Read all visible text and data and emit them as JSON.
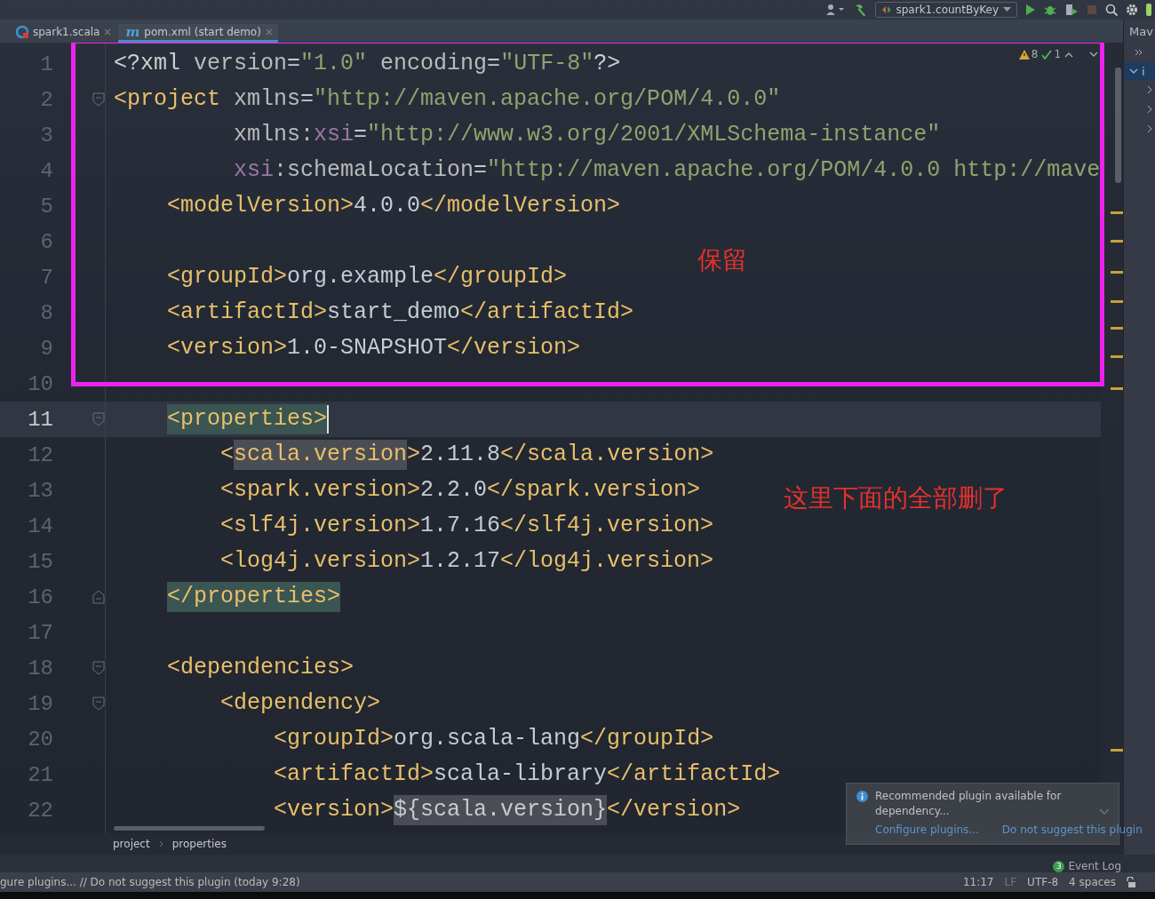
{
  "toolbar": {
    "run_config": "spark1.countByKey"
  },
  "tabs": [
    {
      "label": "spark1.scala",
      "kind": "scala",
      "selected": false
    },
    {
      "label": "pom.xml (start demo)",
      "kind": "maven",
      "icon_text": "m",
      "selected": true
    }
  ],
  "right_panel": {
    "title": "Mav",
    "item": "i"
  },
  "inspections": {
    "warnings": "8",
    "typos": "1"
  },
  "lines": [
    {
      "number": "1",
      "tokens": [
        {
          "kind": "prolog",
          "text": "<?xml"
        },
        {
          "kind": "attr",
          "text": " version"
        },
        {
          "kind": "text",
          "text": "="
        },
        {
          "kind": "value",
          "text": "\"1.0\""
        },
        {
          "kind": "attr",
          "text": " encoding"
        },
        {
          "kind": "text",
          "text": "="
        },
        {
          "kind": "value",
          "text": "\"UTF-8\""
        },
        {
          "kind": "prolog",
          "text": "?>"
        }
      ]
    },
    {
      "number": "2",
      "fold_start": true,
      "tokens": [
        {
          "kind": "tag",
          "text": "<project"
        },
        {
          "kind": "attr",
          "text": " xmlns"
        },
        {
          "kind": "text",
          "text": "="
        },
        {
          "kind": "value",
          "text": "\"http://maven.apache.org/POM/4.0.0\""
        }
      ]
    },
    {
      "number": "3",
      "tokens": [
        {
          "kind": "attr",
          "text": "         xmlns:"
        },
        {
          "kind": "ns",
          "text": "xsi"
        },
        {
          "kind": "text",
          "text": "="
        },
        {
          "kind": "value",
          "text": "\"http://www.w3.org/2001/XMLSchema-instance\""
        }
      ]
    },
    {
      "number": "4",
      "tokens": [
        {
          "kind": "ns",
          "text": "         xsi"
        },
        {
          "kind": "attr",
          "text": ":schemaLocation"
        },
        {
          "kind": "text",
          "text": "="
        },
        {
          "kind": "value",
          "text": "\"http://maven.apache.org/POM/4.0.0 http://mave"
        }
      ]
    },
    {
      "number": "5",
      "tokens": [
        {
          "kind": "tag",
          "text": "    <modelVersion>"
        },
        {
          "kind": "text",
          "text": "4.0.0"
        },
        {
          "kind": "tag",
          "text": "</modelVersion>"
        }
      ]
    },
    {
      "number": "6"
    },
    {
      "number": "7",
      "tokens": [
        {
          "kind": "tag",
          "text": "    <groupId>"
        },
        {
          "kind": "text",
          "text": "org.example"
        },
        {
          "kind": "tag",
          "text": "</groupId>"
        }
      ]
    },
    {
      "number": "8",
      "tokens": [
        {
          "kind": "tag",
          "text": "    <artifactId>"
        },
        {
          "kind": "text",
          "text": "start_demo"
        },
        {
          "kind": "tag",
          "text": "</artifactId>"
        }
      ]
    },
    {
      "number": "9",
      "tokens": [
        {
          "kind": "tag",
          "text": "    <version>"
        },
        {
          "kind": "text",
          "text": "1.0-SNAPSHOT"
        },
        {
          "kind": "tag",
          "text": "</version>"
        }
      ]
    },
    {
      "number": "10"
    },
    {
      "number": "11",
      "fold_start": true,
      "current": true,
      "tokens": [
        {
          "kind": "tag-match",
          "text": "    <properties>"
        }
      ]
    },
    {
      "number": "12",
      "tokens": [
        {
          "kind": "tag",
          "text": "        <"
        },
        {
          "kind": "tag-usage",
          "text": "scala.version"
        },
        {
          "kind": "tag",
          "text": ">"
        },
        {
          "kind": "text",
          "text": "2.11.8"
        },
        {
          "kind": "tag",
          "text": "</scala.version>"
        }
      ]
    },
    {
      "number": "13",
      "tokens": [
        {
          "kind": "tag",
          "text": "        <spark.version>"
        },
        {
          "kind": "text",
          "text": "2.2.0"
        },
        {
          "kind": "tag",
          "text": "</spark.version>"
        }
      ]
    },
    {
      "number": "14",
      "tokens": [
        {
          "kind": "tag",
          "text": "        <slf4j.version>"
        },
        {
          "kind": "text",
          "text": "1.7.16"
        },
        {
          "kind": "tag",
          "text": "</slf4j.version>"
        }
      ]
    },
    {
      "number": "15",
      "tokens": [
        {
          "kind": "tag",
          "text": "        <log4j.version>"
        },
        {
          "kind": "text",
          "text": "1.2.17"
        },
        {
          "kind": "tag",
          "text": "</log4j.version>"
        }
      ]
    },
    {
      "number": "16",
      "fold_end": true,
      "tokens": [
        {
          "kind": "tag-match",
          "text": "    </properties>"
        }
      ]
    },
    {
      "number": "17"
    },
    {
      "number": "18",
      "fold_start": true,
      "tokens": [
        {
          "kind": "tag",
          "text": "    <dependencies>"
        }
      ]
    },
    {
      "number": "19",
      "fold_start": true,
      "tokens": [
        {
          "kind": "tag",
          "text": "        <dependency>"
        }
      ]
    },
    {
      "number": "20",
      "tokens": [
        {
          "kind": "tag",
          "text": "            <groupId>"
        },
        {
          "kind": "text",
          "text": "org.scala-lang"
        },
        {
          "kind": "tag",
          "text": "</groupId>"
        }
      ]
    },
    {
      "number": "21",
      "tokens": [
        {
          "kind": "tag",
          "text": "            <artifactId>"
        },
        {
          "kind": "text",
          "text": "scala-library"
        },
        {
          "kind": "tag",
          "text": "</artifactId>"
        }
      ]
    },
    {
      "number": "22",
      "tokens": [
        {
          "kind": "tag",
          "text": "            <version>"
        },
        {
          "kind": "text-usage",
          "text": "${scala.version}"
        },
        {
          "kind": "tag",
          "text": "</version>"
        }
      ]
    }
  ],
  "annotations": [
    {
      "kind": "frame"
    },
    {
      "kind": "note",
      "text": "保留"
    },
    {
      "kind": "note",
      "text": "这里下面的全部删了"
    }
  ],
  "breadcrumb": [
    "project",
    "properties"
  ],
  "notification": {
    "message": "Recommended plugin available for dependency...",
    "actions": [
      "Configure plugins...",
      "Do not suggest this plugin"
    ]
  },
  "event_log": {
    "label": "Event Log",
    "count": "3"
  },
  "status_bar": {
    "message": "gure plugins... // Do not suggest this plugin (today 9:28)",
    "items": [
      "11:17",
      "LF",
      "UTF-8",
      "4 spaces"
    ]
  }
}
